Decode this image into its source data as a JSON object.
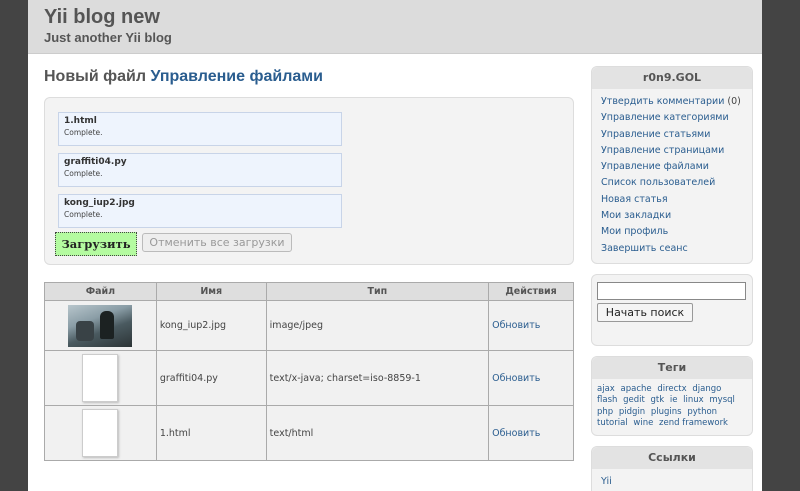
{
  "header": {
    "title": "Yii blog new",
    "tagline": "Just another Yii blog"
  },
  "main": {
    "heading_prefix": "Новый файл",
    "heading_link": "Управление файлами",
    "uploads": [
      {
        "name": "1.html",
        "status": "Complete."
      },
      {
        "name": "graffiti04.py",
        "status": "Complete."
      },
      {
        "name": "kong_iup2.jpg",
        "status": "Complete."
      }
    ],
    "upload_button": "Загрузить",
    "cancel_button": "Отменить все загрузки",
    "table": {
      "headers": [
        "Файл",
        "Имя",
        "Тип",
        "Действия"
      ],
      "rows": [
        {
          "thumb": "photo",
          "name": "kong_iup2.jpg",
          "type": "image/jpeg",
          "action": "Обновить"
        },
        {
          "thumb": "doc",
          "name": "graffiti04.py",
          "type": "text/x-java; charset=iso-8859-1",
          "action": "Обновить"
        },
        {
          "thumb": "doc",
          "name": "1.html",
          "type": "text/html",
          "action": "Обновить"
        }
      ]
    }
  },
  "sidebar": {
    "user_title": "r0n9.GOL",
    "menu": [
      {
        "label": "Утвердить комментарии",
        "suffix": " (0)"
      },
      {
        "label": "Управление категориями",
        "suffix": ""
      },
      {
        "label": "Управление статьями",
        "suffix": ""
      },
      {
        "label": "Управление страницами",
        "suffix": ""
      },
      {
        "label": "Управление файлами",
        "suffix": ""
      },
      {
        "label": "Список пользователей",
        "suffix": ""
      },
      {
        "label": "Новая статья",
        "suffix": ""
      },
      {
        "label": "Мои закладки",
        "suffix": ""
      },
      {
        "label": "Мои профиль",
        "suffix": ""
      },
      {
        "label": "Завершить сеанс",
        "suffix": ""
      }
    ],
    "search_button": "Начать поиск",
    "tags_title": "Теги",
    "tags": [
      "ajax",
      "apache",
      "directx",
      "django",
      "flash",
      "gedit",
      "gtk",
      "ie",
      "linux",
      "mysql",
      "php",
      "pidgin",
      "plugins",
      "python",
      "tutorial",
      "wine",
      "zend framework"
    ],
    "links_title": "Ссылки",
    "links": [
      "Yii"
    ]
  }
}
